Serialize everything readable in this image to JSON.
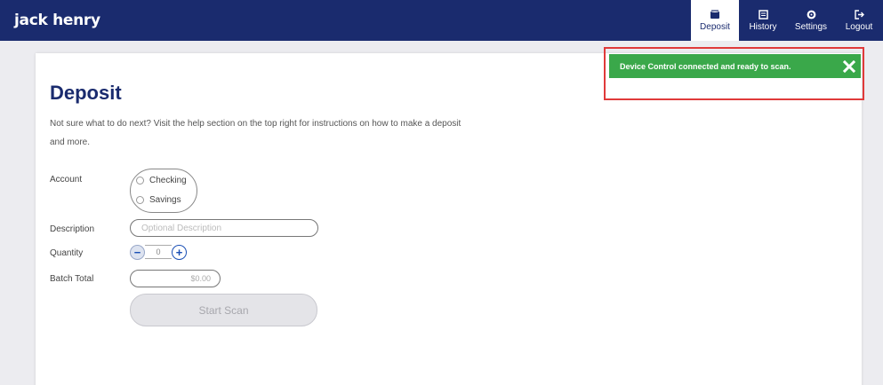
{
  "brand": {
    "logo": "jack henry"
  },
  "nav": {
    "items": [
      {
        "label": "Deposit",
        "icon": "deposit-icon",
        "active": true
      },
      {
        "label": "History",
        "icon": "history-icon"
      },
      {
        "label": "Settings",
        "icon": "gear-icon"
      },
      {
        "label": "Logout",
        "icon": "logout-icon"
      }
    ]
  },
  "page": {
    "title": "Deposit",
    "help_text": "Not sure what to do next? Visit the help section on the top right for instructions on how to make a deposit and more."
  },
  "form": {
    "account": {
      "label": "Account",
      "options": [
        "Checking",
        "Savings"
      ]
    },
    "description": {
      "label": "Description",
      "placeholder": "Optional Description"
    },
    "quantity": {
      "label": "Quantity",
      "value": "0",
      "minus": "−",
      "plus": "+"
    },
    "batch_total": {
      "label": "Batch Total",
      "value": "$0.00"
    },
    "scan_button": "Start Scan"
  },
  "toast": {
    "message": "Device Control connected and ready to scan.",
    "color": "#3aa84a"
  },
  "colors": {
    "brand": "#1a2b6e",
    "highlight": "#e03a3a"
  }
}
